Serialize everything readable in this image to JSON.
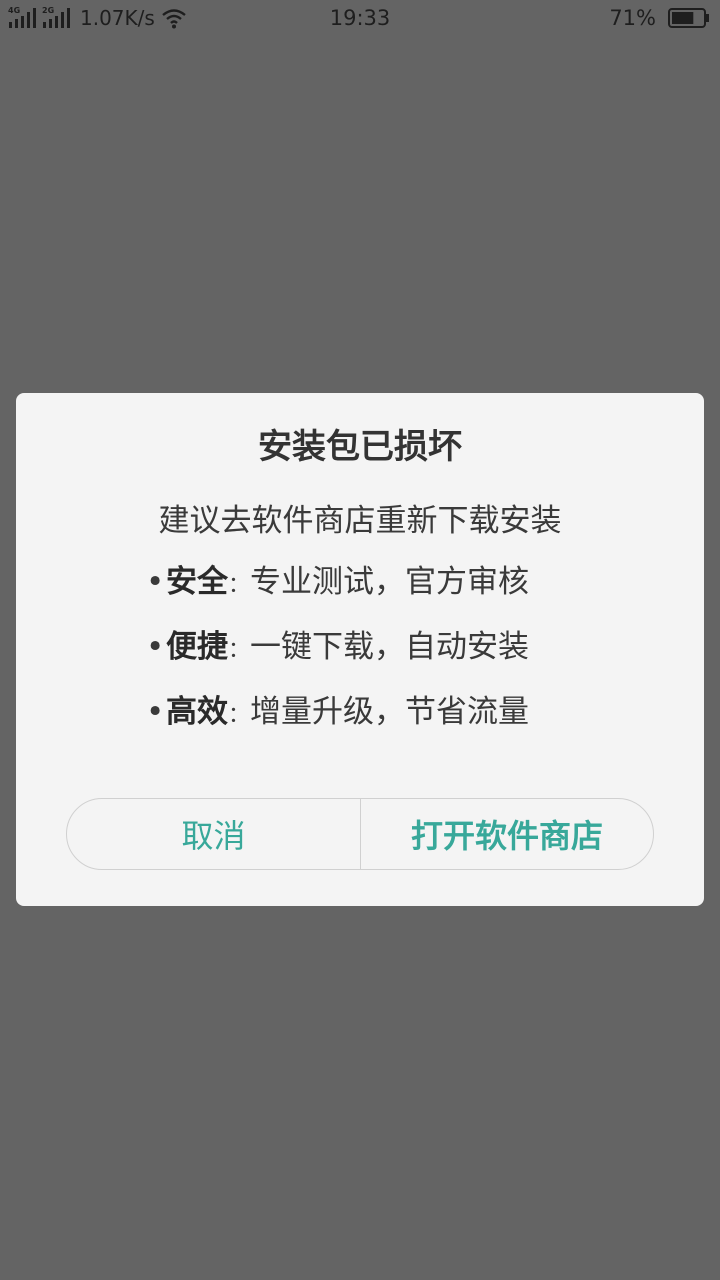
{
  "status_bar": {
    "signal1_tag": "4G",
    "signal2_tag": "2G",
    "net_speed": "1.07K/s",
    "time": "19:33",
    "battery_percent": "71%",
    "battery_level": 0.71,
    "icons": [
      "signal-4g-icon",
      "signal-2g-icon",
      "wifi-icon",
      "battery-icon"
    ]
  },
  "dialog": {
    "title": "安装包已损坏",
    "subtitle": "建议去软件商店重新下载安装",
    "features": [
      {
        "bullet": "•",
        "key": "安全",
        "colon": "：",
        "desc": "专业测试，官方审核"
      },
      {
        "bullet": "•",
        "key": "便捷",
        "colon": "：",
        "desc": "一键下载，自动安装"
      },
      {
        "bullet": "•",
        "key": "高效",
        "colon": "：",
        "desc": "增量升级，节省流量"
      }
    ],
    "cancel_label": "取消",
    "open_label": "打开软件商店",
    "accent_color": "#38a89a"
  }
}
